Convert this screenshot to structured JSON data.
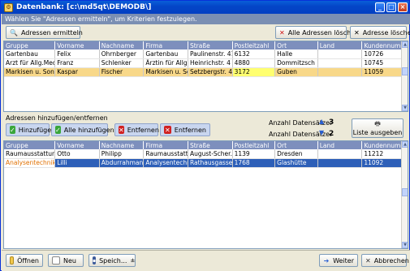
{
  "window": {
    "title": "Datenbank: [c:\\md5qt\\DEMODB\\]",
    "info": "Wählen Sie \"Adressen ermitteln\", um Kriterien festzulegen.",
    "controls": [
      "_",
      "□",
      "×"
    ]
  },
  "toolbar": {
    "find_label": "Adressen ermitteln",
    "delete_all_label": "Alle Adressen löschen",
    "delete_label": "Adresse löschen"
  },
  "columns": [
    "Gruppe",
    "Vorname",
    "Nachname",
    "Firma",
    "Straße",
    "Postleitzahl",
    "Ort",
    "Land",
    "Kundennummer"
  ],
  "top_rows": [
    [
      "Gartenbau",
      "Felix",
      "Ohrnberger",
      "Gartenbau",
      "Paulinenstr. 41",
      "6132",
      "Halle",
      "",
      "10726"
    ],
    [
      "Arzt für Allg.Med.",
      "Franz",
      "Schlenker",
      "Ärztin für Allg....",
      "Heinrichstr. 4",
      "4880",
      "Dommitzsch",
      "",
      "10745"
    ],
    [
      "Markisen u. Sonn...",
      "Kaspar",
      "Fischer",
      "Markisen u. Sonn...",
      "Setzbergstr. 4",
      "3172",
      "Guben",
      "",
      "11059"
    ]
  ],
  "section": {
    "title": "Adressen hinzufügen/entfernen",
    "add_label": "Hinzufügen",
    "add_all_label": "Alle hinzufügen",
    "remove_label": "Entfernen",
    "remove_all_label": "Entfernen",
    "count_top_label": "Anzahl Datensätze:",
    "count_top_value": "3",
    "count_bottom_label": "Anzahl Datensätze:",
    "count_bottom_value": "2",
    "print_label": "Liste ausgeben"
  },
  "bottom_rows": [
    [
      "Raumausstattungen",
      "Otto",
      "Philipp",
      "Raumausstatt...",
      "August-Scher...",
      "1139",
      "Dresden",
      "",
      "11212"
    ],
    [
      "Analysentechnik",
      "Lilli",
      "Abdurrahman",
      "Analysentechnik",
      "Rathausgasse 2",
      "1768",
      "Glashütte",
      "",
      "11092"
    ]
  ],
  "footer": {
    "open_label": "Öffnen",
    "new_label": "Neu",
    "save_label": "Speich...",
    "next_label": "Weiter",
    "cancel_label": "Abbrechen"
  },
  "colors": {
    "titlebar": "#0446c8",
    "header": "#7d8fbd",
    "selected_top": "#f8d889",
    "selected_bottom": "#2d5fb8",
    "accent_orange": "#e07000"
  }
}
